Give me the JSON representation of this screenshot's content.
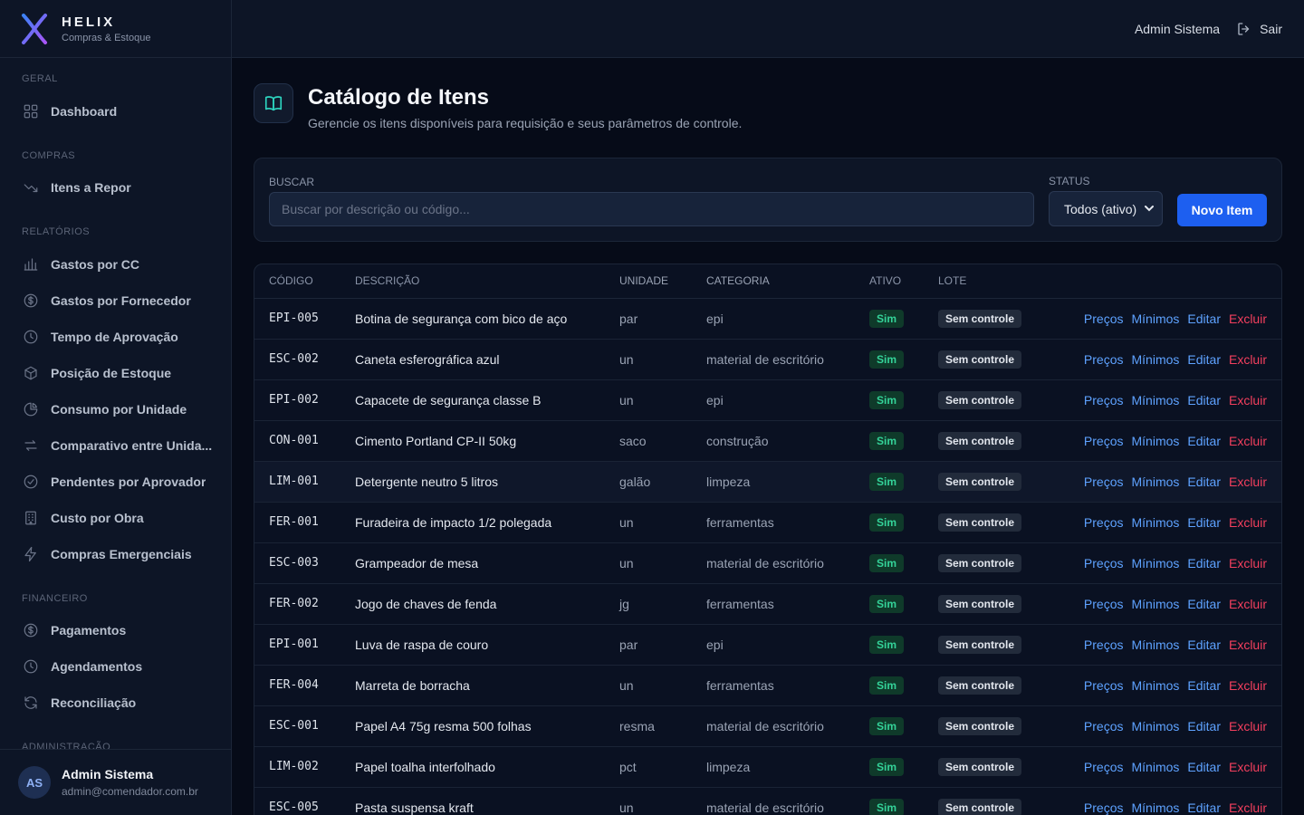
{
  "brand": {
    "name": "HELIX",
    "subtitle": "Compras & Estoque"
  },
  "colors": {
    "accent": "#1d5ff0",
    "link": "#5ea2ff",
    "danger": "#f43f5e",
    "success": "#34d399"
  },
  "sidebar": {
    "sections": [
      {
        "title": "GERAL",
        "items": [
          {
            "label": "Dashboard",
            "icon": "grid-icon"
          }
        ]
      },
      {
        "title": "COMPRAS",
        "items": [
          {
            "label": "Itens a Repor",
            "icon": "trending-down-icon"
          }
        ]
      },
      {
        "title": "RELATÓRIOS",
        "items": [
          {
            "label": "Gastos por CC",
            "icon": "bar-chart-icon"
          },
          {
            "label": "Gastos por Fornecedor",
            "icon": "dollar-circle-icon"
          },
          {
            "label": "Tempo de Aprovação",
            "icon": "clock-icon"
          },
          {
            "label": "Posição de Estoque",
            "icon": "box-icon"
          },
          {
            "label": "Consumo por Unidade",
            "icon": "pie-chart-icon"
          },
          {
            "label": "Comparativo entre Unida...",
            "icon": "arrows-icon"
          },
          {
            "label": "Pendentes por Aprovador",
            "icon": "check-circle-icon"
          },
          {
            "label": "Custo por Obra",
            "icon": "building-icon"
          },
          {
            "label": "Compras Emergenciais",
            "icon": "lightning-icon"
          }
        ]
      },
      {
        "title": "FINANCEIRO",
        "items": [
          {
            "label": "Pagamentos",
            "icon": "dollar-circle-icon"
          },
          {
            "label": "Agendamentos",
            "icon": "clock-icon"
          },
          {
            "label": "Reconciliação",
            "icon": "refresh-icon"
          }
        ]
      },
      {
        "title": "ADMINISTRAÇÃO",
        "items": []
      }
    ]
  },
  "user": {
    "initials": "AS",
    "name": "Admin Sistema",
    "email": "admin@comendador.com.br"
  },
  "topbar": {
    "user_name": "Admin Sistema",
    "logout_label": "Sair"
  },
  "page": {
    "title": "Catálogo de Itens",
    "subtitle": "Gerencie os itens disponíveis para requisição e seus parâmetros de controle."
  },
  "filters": {
    "search_label": "BUSCAR",
    "search_placeholder": "Buscar por descrição ou código...",
    "status_label": "STATUS",
    "status_value": "Todos (ativo)",
    "new_button": "Novo Item"
  },
  "table": {
    "columns": [
      "CÓDIGO",
      "DESCRIÇÃO",
      "UNIDADE",
      "CATEGORIA",
      "ATIVO",
      "LOTE"
    ],
    "actions": {
      "prices": "Preços",
      "minimums": "Mínimos",
      "edit": "Editar",
      "delete": "Excluir"
    },
    "rows": [
      {
        "code": "EPI-005",
        "desc": "Botina de segurança com bico de aço",
        "unit": "par",
        "cat": "epi",
        "ativo": "Sim",
        "lote": "Sem controle"
      },
      {
        "code": "ESC-002",
        "desc": "Caneta esferográfica azul",
        "unit": "un",
        "cat": "material de escritório",
        "ativo": "Sim",
        "lote": "Sem controle"
      },
      {
        "code": "EPI-002",
        "desc": "Capacete de segurança classe B",
        "unit": "un",
        "cat": "epi",
        "ativo": "Sim",
        "lote": "Sem controle"
      },
      {
        "code": "CON-001",
        "desc": "Cimento Portland CP-II 50kg",
        "unit": "saco",
        "cat": "construção",
        "ativo": "Sim",
        "lote": "Sem controle"
      },
      {
        "code": "LIM-001",
        "desc": "Detergente neutro 5 litros",
        "unit": "galão",
        "cat": "limpeza",
        "ativo": "Sim",
        "lote": "Sem controle"
      },
      {
        "code": "FER-001",
        "desc": "Furadeira de impacto 1/2 polegada",
        "unit": "un",
        "cat": "ferramentas",
        "ativo": "Sim",
        "lote": "Sem controle"
      },
      {
        "code": "ESC-003",
        "desc": "Grampeador de mesa",
        "unit": "un",
        "cat": "material de escritório",
        "ativo": "Sim",
        "lote": "Sem controle"
      },
      {
        "code": "FER-002",
        "desc": "Jogo de chaves de fenda",
        "unit": "jg",
        "cat": "ferramentas",
        "ativo": "Sim",
        "lote": "Sem controle"
      },
      {
        "code": "EPI-001",
        "desc": "Luva de raspa de couro",
        "unit": "par",
        "cat": "epi",
        "ativo": "Sim",
        "lote": "Sem controle"
      },
      {
        "code": "FER-004",
        "desc": "Marreta de borracha",
        "unit": "un",
        "cat": "ferramentas",
        "ativo": "Sim",
        "lote": "Sem controle"
      },
      {
        "code": "ESC-001",
        "desc": "Papel A4 75g resma 500 folhas",
        "unit": "resma",
        "cat": "material de escritório",
        "ativo": "Sim",
        "lote": "Sem controle"
      },
      {
        "code": "LIM-002",
        "desc": "Papel toalha interfolhado",
        "unit": "pct",
        "cat": "limpeza",
        "ativo": "Sim",
        "lote": "Sem controle"
      },
      {
        "code": "ESC-005",
        "desc": "Pasta suspensa kraft",
        "unit": "un",
        "cat": "material de escritório",
        "ativo": "Sim",
        "lote": "Sem controle"
      }
    ]
  }
}
